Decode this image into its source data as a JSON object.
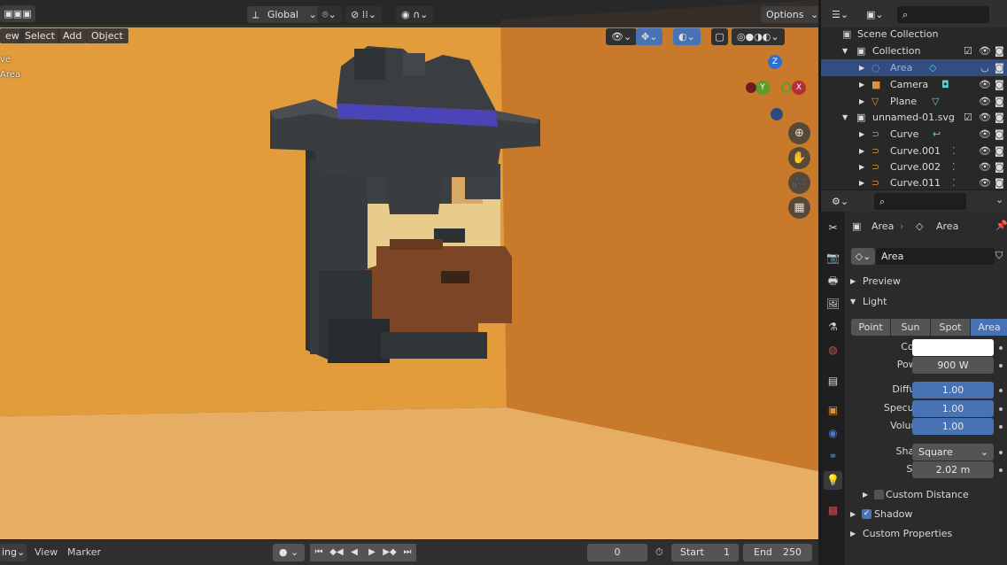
{
  "viewport": {
    "header": {
      "transform_orientation": "Global",
      "options_label": "Options"
    },
    "menus": [
      "ew",
      "Select",
      "Add",
      "Object"
    ],
    "overlay_text": [
      "ve",
      "Area"
    ],
    "gizmo": {
      "z": "Z",
      "y": "Y",
      "x": "X"
    }
  },
  "timeline": {
    "playback_label": "ing",
    "view_label": "View",
    "marker_label": "Marker",
    "current_frame": "0",
    "start_label": "Start",
    "start_value": "1",
    "end_label": "End",
    "end_value": "250"
  },
  "outliner": {
    "rows": [
      {
        "label": "Scene Collection"
      },
      {
        "label": "Collection"
      },
      {
        "label": "Area"
      },
      {
        "label": "Camera"
      },
      {
        "label": "Plane"
      },
      {
        "label": "unnamed-01.svg"
      },
      {
        "label": "Curve"
      },
      {
        "label": "Curve.001"
      },
      {
        "label": "Curve.002"
      },
      {
        "label": "Curve.011"
      }
    ]
  },
  "properties": {
    "breadcrumb_object": "Area",
    "breadcrumb_data": "Area",
    "datablock_name": "Area",
    "preview_label": "Preview",
    "light_label": "Light",
    "light_types": [
      "Point",
      "Sun",
      "Spot",
      "Area"
    ],
    "active_light_type": "Area",
    "color_label": "Color",
    "color_value": "#ffffff",
    "power_label": "Power",
    "power_value": "900 W",
    "diffuse_label": "Diffuse",
    "diffuse_value": "1.00",
    "specular_label": "Specular",
    "specular_value": "1.00",
    "volume_label": "Volume",
    "volume_value": "1.00",
    "shape_label": "Shape",
    "shape_value": "Square",
    "size_label": "Size",
    "size_value": "2.02 m",
    "custom_distance_label": "Custom Distance",
    "shadow_label": "Shadow",
    "custom_properties_label": "Custom Properties"
  },
  "colors": {
    "accent": "#4772b3",
    "selection": "#334d80",
    "wall_orange": "#e09a3a",
    "hat_band": "#4b44b8",
    "beard": "#7a4423"
  }
}
